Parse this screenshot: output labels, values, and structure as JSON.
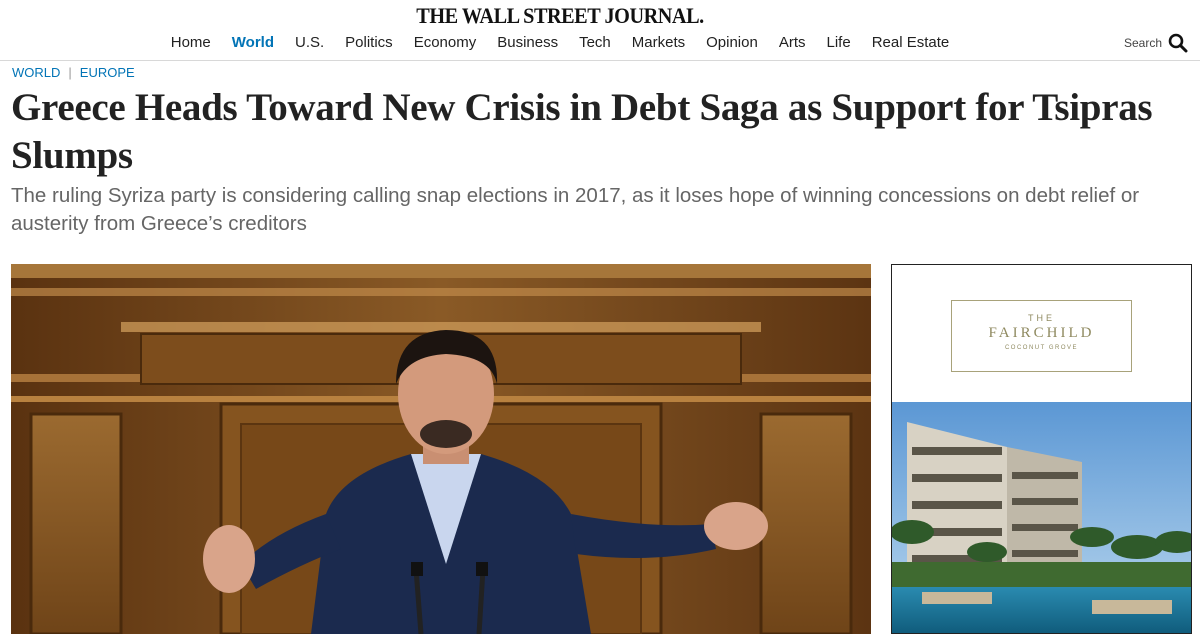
{
  "masthead": {
    "logo": "THE WALL STREET JOURNAL.",
    "nav": [
      {
        "label": "Home",
        "active": false
      },
      {
        "label": "World",
        "active": true
      },
      {
        "label": "U.S.",
        "active": false
      },
      {
        "label": "Politics",
        "active": false
      },
      {
        "label": "Economy",
        "active": false
      },
      {
        "label": "Business",
        "active": false
      },
      {
        "label": "Tech",
        "active": false
      },
      {
        "label": "Markets",
        "active": false
      },
      {
        "label": "Opinion",
        "active": false
      },
      {
        "label": "Arts",
        "active": false
      },
      {
        "label": "Life",
        "active": false
      },
      {
        "label": "Real Estate",
        "active": false
      }
    ],
    "search_label": "Search",
    "search_icon": "search-icon"
  },
  "article": {
    "breadcrumb": [
      "WORLD",
      "EUROPE"
    ],
    "headline": "Greece Heads Toward New Crisis in Debt Saga as Support for Tsipras Slumps",
    "dek": "The ruling Syriza party is considering calling snap elections in 2017, as it loses hope of winning concessions on debt relief or austerity from Greece’s creditors"
  },
  "ad": {
    "brand_the": "THE",
    "brand_name": "FAIRCHILD",
    "brand_sub": "COCONUT GROVE"
  },
  "colors": {
    "accent": "#0274b6",
    "headline": "#222222",
    "dek": "#666666",
    "ad_gold": "#8f8a60"
  }
}
